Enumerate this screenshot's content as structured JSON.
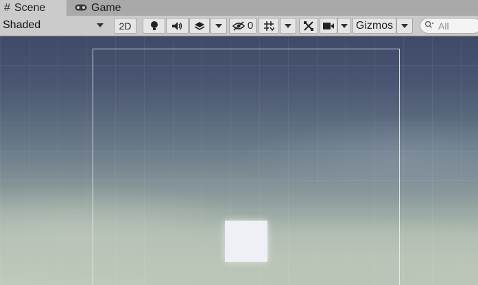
{
  "tabs": [
    {
      "label": "Scene",
      "icon": "hash-icon",
      "active": true
    },
    {
      "label": "Game",
      "icon": "gamepad-icon",
      "active": false
    }
  ],
  "toolbar": {
    "draw_mode": "Shaded",
    "mode_2d": "2D",
    "hidden_count": "0",
    "gizmos_label": "Gizmos",
    "search_placeholder": "All"
  }
}
